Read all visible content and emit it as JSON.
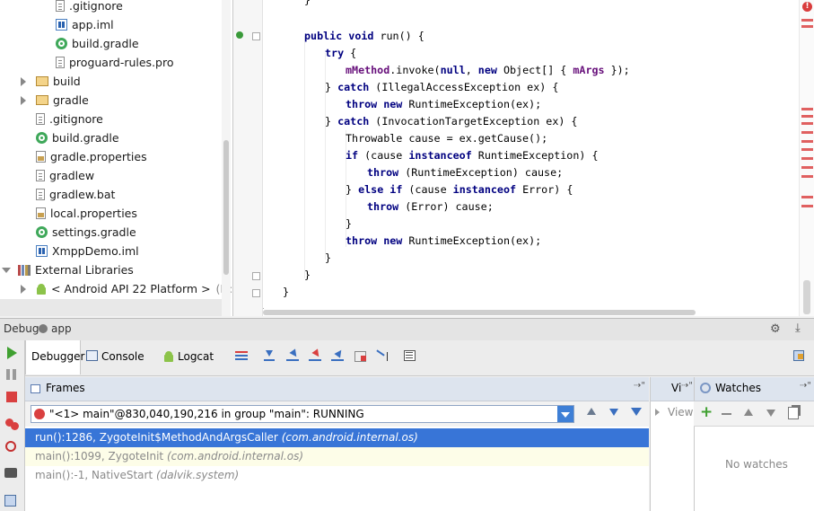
{
  "project_tree": {
    "items": [
      {
        "label": ".gitignore",
        "icon": "file-icon"
      },
      {
        "label": "app.iml",
        "icon": "iml-icon"
      },
      {
        "label": "build.gradle",
        "icon": "gradle-icon"
      },
      {
        "label": "proguard-rules.pro",
        "icon": "file-icon"
      },
      {
        "label": "build",
        "icon": "folder-icon"
      },
      {
        "label": "gradle",
        "icon": "folder-icon"
      },
      {
        "label": ".gitignore",
        "icon": "file-icon"
      },
      {
        "label": "build.gradle",
        "icon": "gradle-icon"
      },
      {
        "label": "gradle.properties",
        "icon": "properties-icon"
      },
      {
        "label": "gradlew",
        "icon": "file-icon"
      },
      {
        "label": "gradlew.bat",
        "icon": "file-icon"
      },
      {
        "label": "local.properties",
        "icon": "properties-icon"
      },
      {
        "label": "settings.gradle",
        "icon": "gradle-icon"
      },
      {
        "label": "XmppDemo.iml",
        "icon": "iml-icon"
      },
      {
        "label": "External Libraries",
        "icon": "library-icon"
      },
      {
        "label": "< Android API 22 Platform >",
        "suffix": "(D:₩",
        "icon": "android-icon"
      }
    ]
  },
  "editor": {
    "lines": [
      {
        "tokens": [
          [
            "}",
            ""
          ]
        ]
      },
      {
        "tokens": [
          [
            "public",
            "kw"
          ],
          [
            " ",
            ""
          ],
          [
            "void",
            "kw"
          ],
          [
            " run() {",
            ""
          ]
        ]
      },
      {
        "tokens": [
          [
            "try",
            "kw"
          ],
          [
            " {",
            ""
          ]
        ]
      },
      {
        "tokens": [
          [
            "mMethod",
            "fld"
          ],
          [
            ".invoke(",
            ""
          ],
          [
            "null",
            "kw"
          ],
          [
            ", ",
            ""
          ],
          [
            "new",
            "kw"
          ],
          [
            " Object[] { ",
            ""
          ],
          [
            "mArgs",
            "fld"
          ],
          [
            " });",
            ""
          ]
        ]
      },
      {
        "tokens": [
          [
            "} ",
            ""
          ],
          [
            "catch",
            "kw"
          ],
          [
            " (IllegalAccessException ex) {",
            ""
          ]
        ]
      },
      {
        "tokens": [
          [
            "throw",
            "kw"
          ],
          [
            " ",
            ""
          ],
          [
            "new",
            "kw"
          ],
          [
            " RuntimeException(ex);",
            ""
          ]
        ]
      },
      {
        "tokens": [
          [
            "} ",
            ""
          ],
          [
            "catch",
            "kw"
          ],
          [
            " (InvocationTargetException ex) {",
            ""
          ]
        ]
      },
      {
        "tokens": [
          [
            "Throwable cause = ex.getCause();",
            ""
          ]
        ]
      },
      {
        "tokens": [
          [
            "if",
            "kw"
          ],
          [
            " (cause ",
            ""
          ],
          [
            "instanceof",
            "kw"
          ],
          [
            " RuntimeException) {",
            ""
          ]
        ]
      },
      {
        "tokens": [
          [
            "throw",
            "kw"
          ],
          [
            " (RuntimeException) cause;",
            ""
          ]
        ]
      },
      {
        "tokens": [
          [
            "} ",
            ""
          ],
          [
            "else",
            "kw"
          ],
          [
            " ",
            ""
          ],
          [
            "if",
            "kw"
          ],
          [
            " (cause ",
            ""
          ],
          [
            "instanceof",
            "kw"
          ],
          [
            " Error) {",
            ""
          ]
        ]
      },
      {
        "tokens": [
          [
            "throw",
            "kw"
          ],
          [
            " (Error) cause;",
            ""
          ]
        ]
      },
      {
        "tokens": [
          [
            "}",
            ""
          ]
        ]
      },
      {
        "tokens": [
          [
            "throw",
            "kw"
          ],
          [
            " ",
            ""
          ],
          [
            "new",
            "kw"
          ],
          [
            " RuntimeException(ex);",
            ""
          ]
        ]
      },
      {
        "tokens": [
          [
            "}",
            ""
          ]
        ]
      },
      {
        "tokens": [
          [
            "}",
            ""
          ]
        ]
      },
      {
        "tokens": [
          [
            "}",
            ""
          ]
        ]
      },
      {
        "tokens": [
          [
            "}",
            ""
          ]
        ]
      }
    ]
  },
  "debug": {
    "title": "Debug",
    "config": "app",
    "tabs": {
      "debugger": "Debugger",
      "console": "Console",
      "logcat": "Logcat"
    },
    "frames_title": "Frames",
    "variables_title": "Vi",
    "watches_title": "Watches",
    "thread": "\"<1> main\"@830,040,190,216 in group \"main\": RUNNING",
    "frames": [
      {
        "method": "run():1286, ZygoteInit$MethodAndArgsCaller",
        "pkg": "(com.android.internal.os)",
        "state": "selected"
      },
      {
        "method": "main():1099, ZygoteInit",
        "pkg": "(com.android.internal.os)",
        "state": "library"
      },
      {
        "method": "main():-1, NativeStart",
        "pkg": "(dalvik.system)",
        "state": "library"
      }
    ],
    "view_label": "View",
    "no_watches": "No watches",
    "colors": {
      "selected": "#3875d7",
      "library_bg": "#fdfde8",
      "header_bg": "#dde4ee",
      "run_green": "#3fa030"
    }
  }
}
